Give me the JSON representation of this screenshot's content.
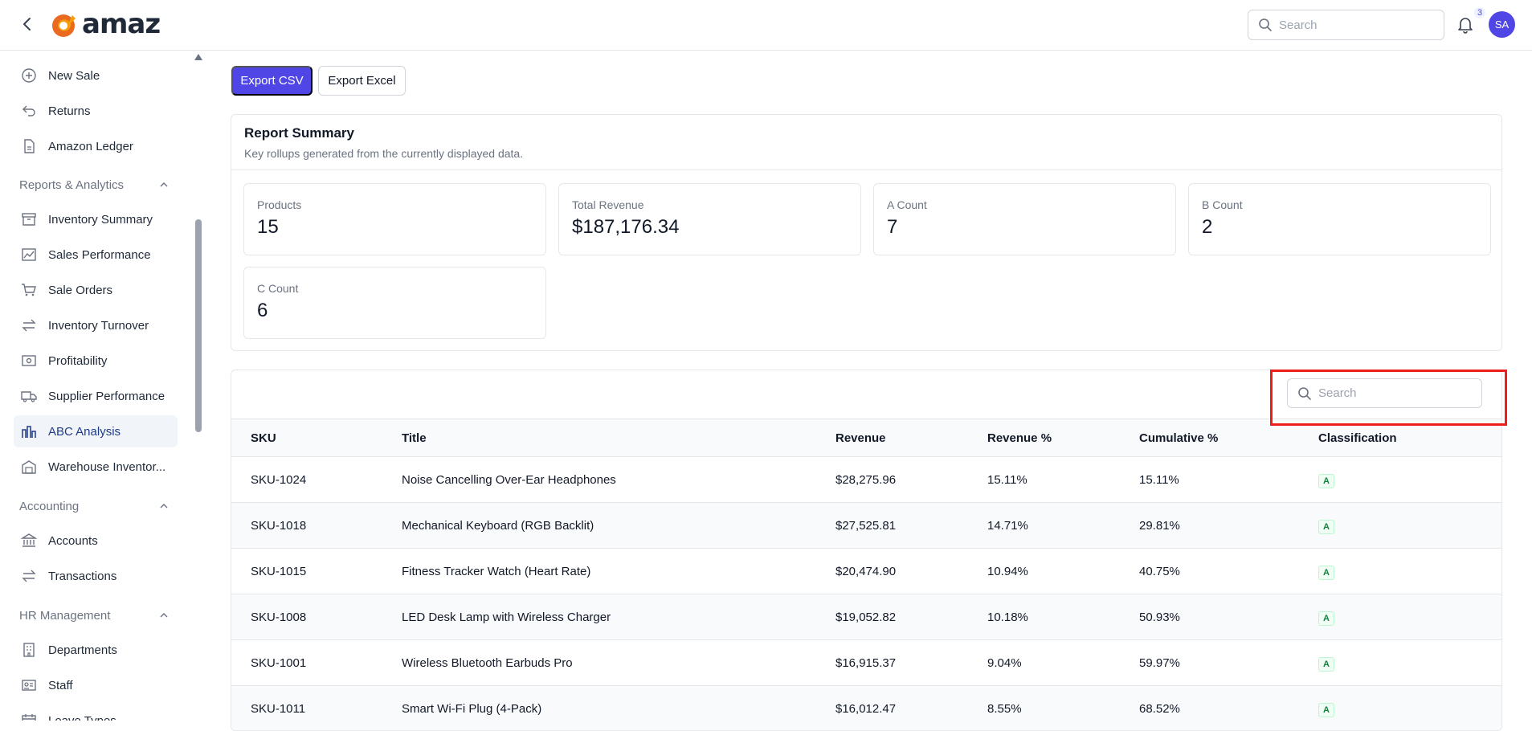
{
  "header": {
    "logo_text": "amaz",
    "search_placeholder": "Search",
    "notification_count": "3",
    "avatar_initials": "SA"
  },
  "sidebar": {
    "items_top": [
      {
        "label": "New Sale",
        "icon": "plus-circle-icon"
      },
      {
        "label": "Returns",
        "icon": "undo-icon"
      },
      {
        "label": "Amazon Ledger",
        "icon": "document-icon"
      }
    ],
    "section_reports": "Reports & Analytics",
    "reports_items": [
      {
        "label": "Inventory Summary",
        "icon": "archive-icon"
      },
      {
        "label": "Sales Performance",
        "icon": "trend-chart-icon"
      },
      {
        "label": "Sale Orders",
        "icon": "cart-icon"
      },
      {
        "label": "Inventory Turnover",
        "icon": "swap-arrows-icon"
      },
      {
        "label": "Profitability",
        "icon": "money-icon"
      },
      {
        "label": "Supplier Performance",
        "icon": "truck-icon"
      },
      {
        "label": "ABC Analysis",
        "icon": "bar-chart-icon",
        "active": true
      },
      {
        "label": "Warehouse Inventor...",
        "icon": "warehouse-icon"
      }
    ],
    "section_accounting": "Accounting",
    "accounting_items": [
      {
        "label": "Accounts",
        "icon": "bank-icon"
      },
      {
        "label": "Transactions",
        "icon": "swap-arrows-icon"
      }
    ],
    "section_hr": "HR Management",
    "hr_items": [
      {
        "label": "Departments",
        "icon": "building-icon"
      },
      {
        "label": "Staff",
        "icon": "id-card-icon"
      },
      {
        "label": "Leave Types",
        "icon": "calendar-icon"
      }
    ]
  },
  "actions": {
    "export_csv": "Export CSV",
    "export_excel": "Export Excel"
  },
  "summary": {
    "title": "Report Summary",
    "subtitle": "Key rollups generated from the currently displayed data.",
    "stats": [
      {
        "label": "Products",
        "value": "15"
      },
      {
        "label": "Total Revenue",
        "value": "$187,176.34"
      },
      {
        "label": "A Count",
        "value": "7"
      },
      {
        "label": "B Count",
        "value": "2"
      },
      {
        "label": "C Count",
        "value": "6"
      }
    ]
  },
  "table": {
    "search_placeholder": "Search",
    "columns": [
      "SKU",
      "Title",
      "Revenue",
      "Revenue %",
      "Cumulative %",
      "Classification"
    ],
    "rows": [
      {
        "sku": "SKU-1024",
        "title": "Noise Cancelling Over-Ear Headphones",
        "revenue": "$28,275.96",
        "revenue_pct": "15.11%",
        "cumulative_pct": "15.11%",
        "classification": "A"
      },
      {
        "sku": "SKU-1018",
        "title": "Mechanical Keyboard (RGB Backlit)",
        "revenue": "$27,525.81",
        "revenue_pct": "14.71%",
        "cumulative_pct": "29.81%",
        "classification": "A"
      },
      {
        "sku": "SKU-1015",
        "title": "Fitness Tracker Watch (Heart Rate)",
        "revenue": "$20,474.90",
        "revenue_pct": "10.94%",
        "cumulative_pct": "40.75%",
        "classification": "A"
      },
      {
        "sku": "SKU-1008",
        "title": "LED Desk Lamp with Wireless Charger",
        "revenue": "$19,052.82",
        "revenue_pct": "10.18%",
        "cumulative_pct": "50.93%",
        "classification": "A"
      },
      {
        "sku": "SKU-1001",
        "title": "Wireless Bluetooth Earbuds Pro",
        "revenue": "$16,915.37",
        "revenue_pct": "9.04%",
        "cumulative_pct": "59.97%",
        "classification": "A"
      },
      {
        "sku": "SKU-1011",
        "title": "Smart Wi-Fi Plug (4-Pack)",
        "revenue": "$16,012.47",
        "revenue_pct": "8.55%",
        "cumulative_pct": "68.52%",
        "classification": "A"
      }
    ]
  },
  "colors": {
    "primary": "#4f46e5",
    "highlight": "#ef1c1c",
    "badge_green": "#15803d"
  }
}
